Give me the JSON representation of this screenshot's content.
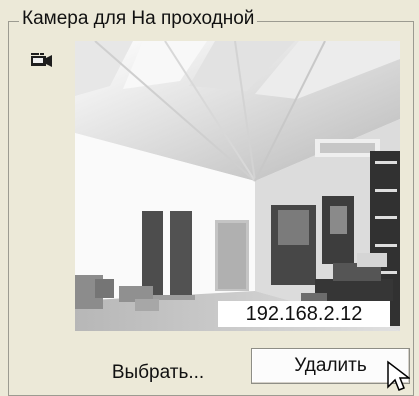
{
  "groupbox": {
    "title": "Камера для На проходной"
  },
  "camera": {
    "icon": "video-camera-icon",
    "ip": "192.168.2.12"
  },
  "buttons": {
    "select_label": "Выбрать...",
    "delete_label": "Удалить"
  },
  "cursor": {
    "icon": "mouse-pointer-icon"
  },
  "colors": {
    "background": "#ece9d8",
    "border": "#9c9b91",
    "button_face": "#fcfcfc",
    "ip_label_background": "#ffffff"
  }
}
